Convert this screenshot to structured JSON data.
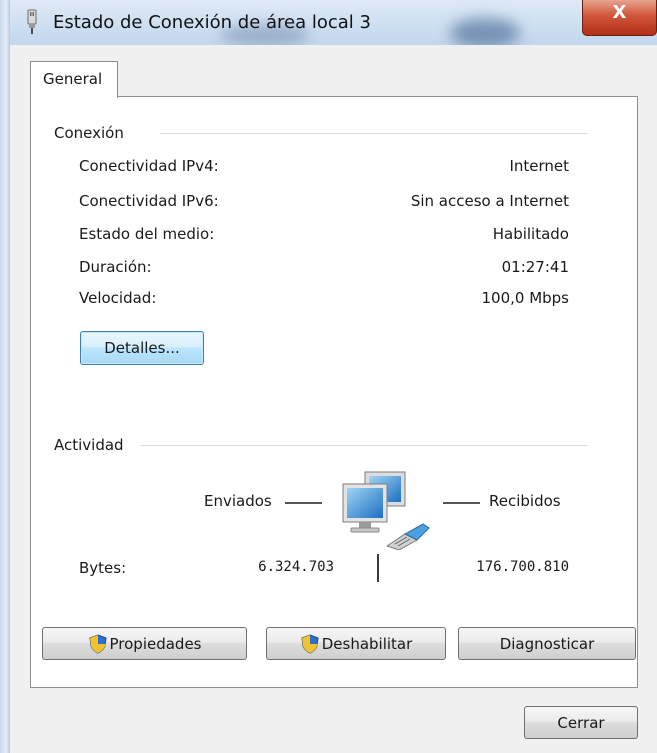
{
  "window": {
    "title": "Estado de Conexión de área local 3",
    "close_label": "X"
  },
  "tabs": [
    {
      "label": "General"
    }
  ],
  "connection": {
    "heading": "Conexión",
    "rows": [
      {
        "label": "Conectividad IPv4:",
        "value": "Internet"
      },
      {
        "label": "Conectividad IPv6:",
        "value": "Sin acceso a Internet"
      },
      {
        "label": "Estado del medio:",
        "value": "Habilitado"
      },
      {
        "label": "Duración:",
        "value": "01:27:41"
      },
      {
        "label": "Velocidad:",
        "value": "100,0 Mbps"
      }
    ],
    "details_button": "Detalles..."
  },
  "activity": {
    "heading": "Actividad",
    "sent_label": "Enviados",
    "received_label": "Recibidos",
    "bytes_label": "Bytes:",
    "bytes_sent": "6.324.703",
    "bytes_received": "176.700.810"
  },
  "actions": {
    "properties": "Propiedades",
    "disable": "Deshabilitar",
    "diagnose": "Diagnosticar"
  },
  "footer": {
    "close": "Cerrar"
  },
  "icons": {
    "title": "network-adapter-icon",
    "activity": "network-computers-icon",
    "uac": "uac-shield-icon"
  }
}
